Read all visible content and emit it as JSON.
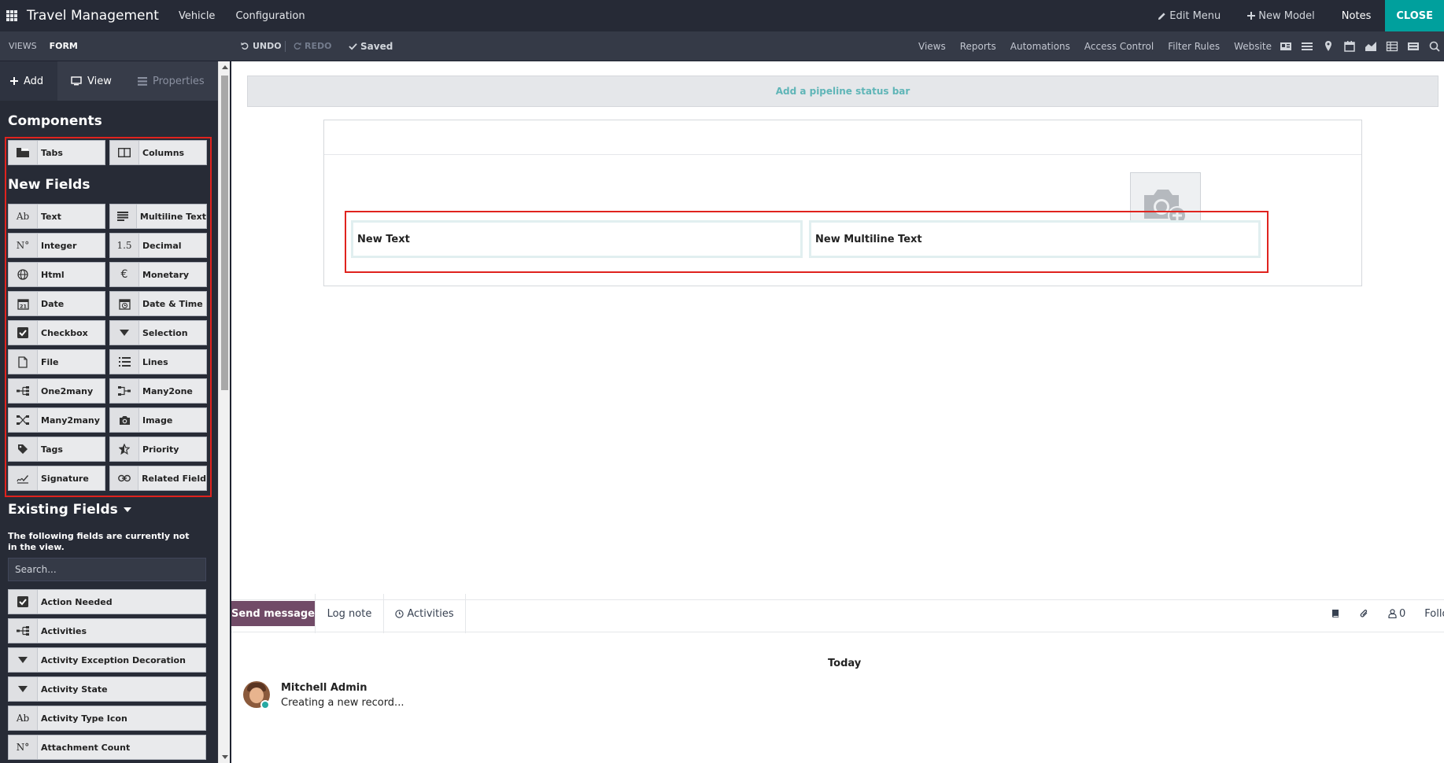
{
  "topbar": {
    "app_title": "Travel Management",
    "menus": [
      "Vehicle",
      "Configuration"
    ],
    "edit_menu": "Edit Menu",
    "new_model": "New Model",
    "notes": "Notes",
    "close": "CLOSE"
  },
  "studiobar": {
    "breadcrumb_views": "VIEWS",
    "breadcrumb_form": "FORM",
    "undo": "UNDO",
    "redo": "REDO",
    "saved": "Saved",
    "links": [
      "Views",
      "Reports",
      "Automations",
      "Access Control",
      "Filter Rules",
      "Website"
    ]
  },
  "sidebar": {
    "tabs": {
      "add": "Add",
      "view": "View",
      "properties": "Properties"
    },
    "components_title": "Components",
    "components": [
      {
        "label": "Tabs",
        "icon": "tabs-icon"
      },
      {
        "label": "Columns",
        "icon": "columns-icon"
      }
    ],
    "new_fields_title": "New Fields",
    "new_fields": [
      {
        "label": "Text",
        "icon": "text-icon"
      },
      {
        "label": "Multiline Text",
        "icon": "multiline-text-icon"
      },
      {
        "label": "Integer",
        "icon": "integer-icon"
      },
      {
        "label": "Decimal",
        "icon": "decimal-icon"
      },
      {
        "label": "Html",
        "icon": "globe-icon"
      },
      {
        "label": "Monetary",
        "icon": "euro-icon"
      },
      {
        "label": "Date",
        "icon": "calendar-icon"
      },
      {
        "label": "Date & Time",
        "icon": "calendar-clock-icon"
      },
      {
        "label": "Checkbox",
        "icon": "checkbox-icon"
      },
      {
        "label": "Selection",
        "icon": "caret-down-icon"
      },
      {
        "label": "File",
        "icon": "file-icon"
      },
      {
        "label": "Lines",
        "icon": "list-icon"
      },
      {
        "label": "One2many",
        "icon": "one2many-icon"
      },
      {
        "label": "Many2one",
        "icon": "many2one-icon"
      },
      {
        "label": "Many2many",
        "icon": "many2many-icon"
      },
      {
        "label": "Image",
        "icon": "camera-icon"
      },
      {
        "label": "Tags",
        "icon": "tag-icon"
      },
      {
        "label": "Priority",
        "icon": "star-icon"
      },
      {
        "label": "Signature",
        "icon": "signature-icon"
      },
      {
        "label": "Related Field",
        "icon": "link-icon"
      }
    ],
    "existing_title": "Existing Fields",
    "existing_note": "The following fields are currently not in the view.",
    "search_placeholder": "Search...",
    "existing_fields": [
      {
        "label": "Action Needed",
        "icon": "checkbox-icon"
      },
      {
        "label": "Activities",
        "icon": "one2many-icon"
      },
      {
        "label": "Activity Exception Decoration",
        "icon": "caret-down-icon"
      },
      {
        "label": "Activity State",
        "icon": "caret-down-icon"
      },
      {
        "label": "Activity Type Icon",
        "icon": "text-icon"
      },
      {
        "label": "Attachment Count",
        "icon": "integer-icon"
      }
    ]
  },
  "form": {
    "pipeline_label": "Add a pipeline status bar",
    "fields": [
      "New Text",
      "New Multiline Text"
    ]
  },
  "chatter": {
    "send_message": "Send message",
    "log_note": "Log note",
    "activities": "Activities",
    "followers_count": "0",
    "follow": "Follow",
    "today": "Today",
    "author": "Mitchell Admin",
    "message": "Creating a new record..."
  },
  "colors": {
    "accent": "#00A09D",
    "primary": "#714B67",
    "highlight": "#e0231e"
  }
}
